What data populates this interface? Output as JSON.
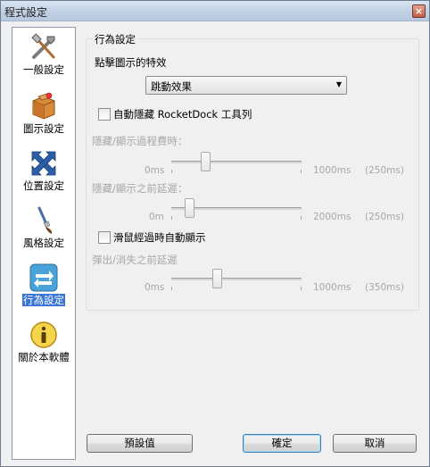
{
  "window": {
    "title": "程式設定",
    "close_symbol": "×"
  },
  "sidebar": {
    "items": [
      {
        "label": "一般設定",
        "icon": "tools-icon",
        "active": false
      },
      {
        "label": "圖示設定",
        "icon": "box-icon",
        "active": false
      },
      {
        "label": "位置設定",
        "icon": "move-arrows-icon",
        "active": false
      },
      {
        "label": "風格設定",
        "icon": "paintbrush-icon",
        "active": false
      },
      {
        "label": "行為設定",
        "icon": "swap-arrows-icon",
        "active": true
      },
      {
        "label": "關於本軟體",
        "icon": "info-icon",
        "active": false
      }
    ]
  },
  "group": {
    "title": "行為設定",
    "effect_label": "點擊圖示的特效",
    "effect_value": "跳動效果",
    "autohide_label": "自動隱藏 RocketDock 工具列",
    "autohide_checked": false,
    "hide_duration": {
      "label": "隱藏/顯示過程費時：",
      "min": "0ms",
      "max": "1000ms",
      "current": "(250ms)",
      "fraction": 0.25
    },
    "hide_delay": {
      "label": "隱藏/顯示之前延遲：",
      "min": "0m",
      "max": "2000ms",
      "current": "(250ms)",
      "fraction": 0.125
    },
    "mouseover_label": "滑鼠經過時自動顯示",
    "mouseover_checked": false,
    "popup_delay": {
      "label": "彈出/消失之前延遲",
      "min": "0ms",
      "max": "1000ms",
      "current": "(350ms)",
      "fraction": 0.35
    }
  },
  "buttons": {
    "defaults": "預設值",
    "ok": "確定",
    "cancel": "取消"
  }
}
